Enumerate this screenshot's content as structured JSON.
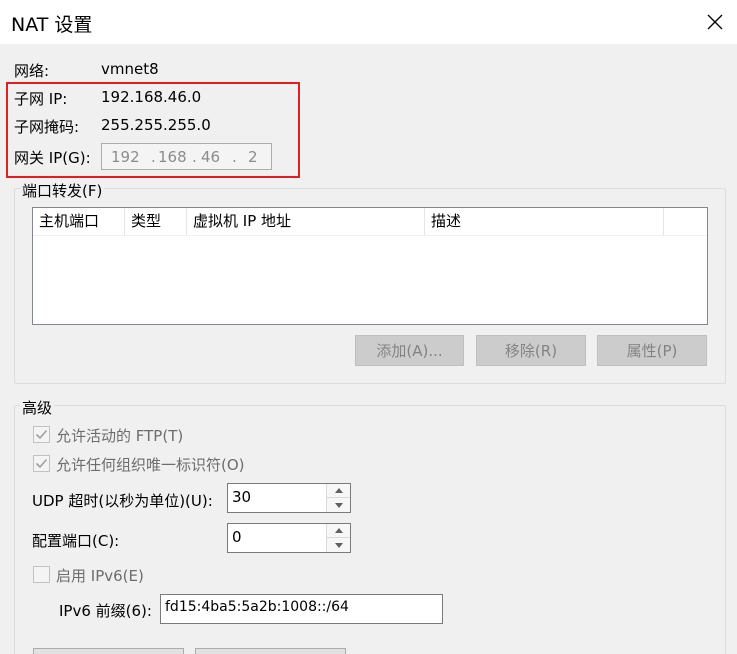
{
  "window": {
    "title": "NAT 设置"
  },
  "network": {
    "network_label": "网络:",
    "network_value": "vmnet8",
    "subnet_ip_label": "子网 IP:",
    "subnet_ip_value": "192.168.46.0",
    "subnet_mask_label": "子网掩码:",
    "subnet_mask_value": "255.255.255.0",
    "gateway_label": "网关 IP(G):",
    "gateway_octets": [
      "192",
      ".",
      "168",
      ".",
      "46",
      ".",
      "2"
    ]
  },
  "port_forwarding": {
    "group_title": "端口转发(F)",
    "columns": [
      "主机端口",
      "类型",
      "虚拟机 IP 地址",
      "描述"
    ],
    "rows": [],
    "buttons": {
      "add": "添加(A)...",
      "remove": "移除(R)",
      "properties": "属性(P)"
    }
  },
  "advanced": {
    "group_title": "高级",
    "allow_active_ftp": {
      "label": "允许活动的 FTP(T)",
      "checked": true,
      "disabled": true
    },
    "allow_any_oui": {
      "label": "允许任何组织唯一标识符(O)",
      "checked": true,
      "disabled": true
    },
    "udp_timeout": {
      "label": "UDP 超时(以秒为单位)(U):",
      "value": "30"
    },
    "config_port": {
      "label": "配置端口(C):",
      "value": "0"
    },
    "enable_ipv6": {
      "label": "启用 IPv6(E)",
      "checked": false,
      "disabled": true
    },
    "ipv6_prefix": {
      "label": "IPv6 前缀(6):",
      "value": "fd15:4ba5:5a2b:1008::/64"
    }
  },
  "colors": {
    "highlight_box": "#e02020",
    "window_bg": "#f0f0f0",
    "disabled_text": "#838383"
  }
}
